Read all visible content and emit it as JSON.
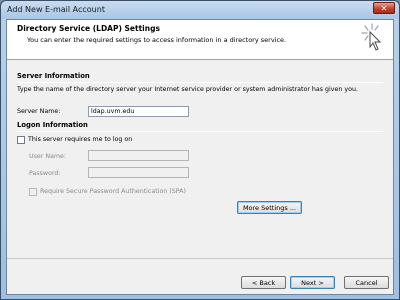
{
  "window": {
    "title": "Add New E-mail Account",
    "close_label": "✕"
  },
  "header": {
    "title": "Directory Service (LDAP) Settings",
    "subtitle": "You can enter the required settings to access information in a directory service."
  },
  "server_info": {
    "heading": "Server Information",
    "description": "Type the name of the directory server your Internet service provider or system administrator has given you.",
    "server_name_label": "Server Name:",
    "server_name_value": "ldap.uvm.edu"
  },
  "logon_info": {
    "heading": "Logon Information",
    "requires_logon_label": "This server requires me to log on",
    "requires_logon_checked": false,
    "user_name_label": "User Name:",
    "user_name_value": "",
    "password_label": "Password:",
    "password_value": "",
    "spa_label": "Require Secure Password Authentication (SPA)",
    "spa_checked": false
  },
  "buttons": {
    "more_settings": "More Settings ...",
    "back": "< Back",
    "next": "Next >",
    "cancel": "Cancel"
  },
  "colors": {
    "title_bar": "#b9d1ea",
    "close_button": "#c24533",
    "focus_border": "#3c7fb1"
  }
}
